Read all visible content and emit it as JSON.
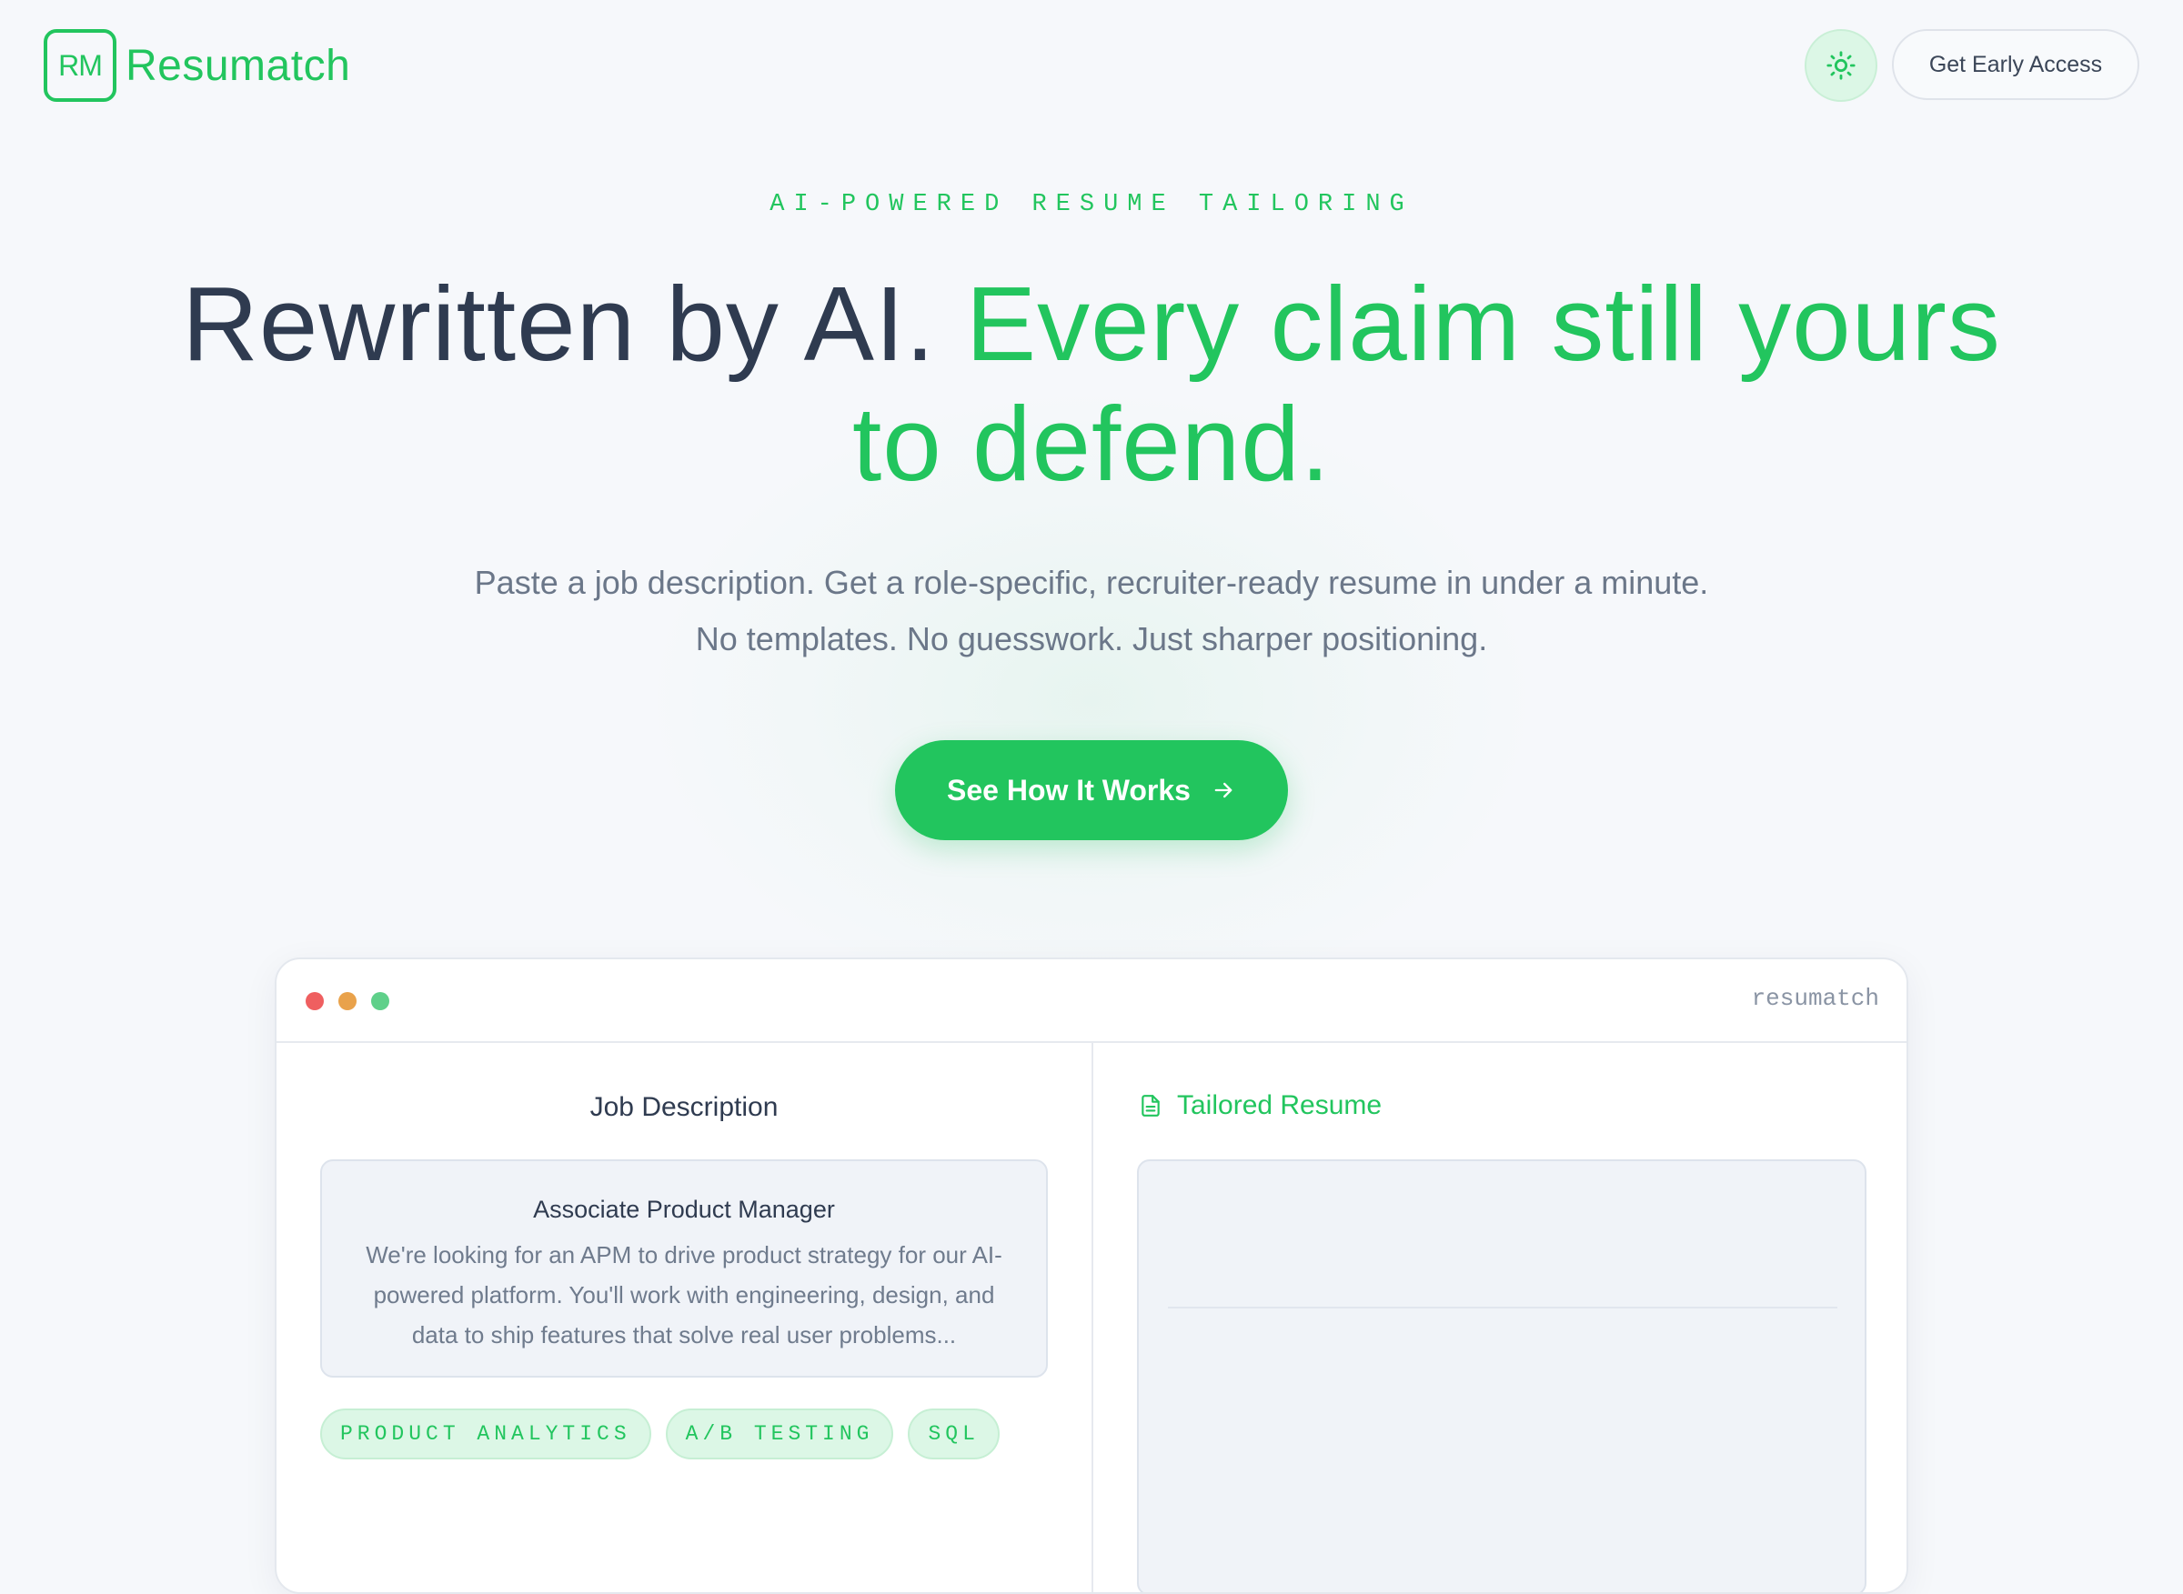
{
  "header": {
    "logo_mark": "RM",
    "logo_text": "Resumatch",
    "theme_icon": "sun-icon",
    "cta_label": "Get Early Access"
  },
  "hero": {
    "eyebrow": "AI-POWERED RESUME TAILORING",
    "headline_dark": "Rewritten by AI.",
    "headline_green": "Every claim still yours to defend.",
    "subhead": "Paste a job description. Get a role-specific, recruiter-ready resume in under a minute. No templates. No guesswork. Just sharper positioning.",
    "button_label": "See How It Works",
    "button_icon": "arrow-right-icon"
  },
  "demo": {
    "window_label": "resumatch",
    "left_panel": {
      "title": "Job Description",
      "job_title": "Associate Product Manager",
      "job_body": "We're looking for an APM to drive product strategy for our AI-powered platform. You'll work with engineering, design, and data to ship features that solve real user problems...",
      "tags": [
        "PRODUCT ANALYTICS",
        "A/B TESTING",
        "SQL"
      ]
    },
    "right_panel": {
      "title": "Tailored Resume",
      "title_icon": "document-icon"
    }
  },
  "colors": {
    "accent": "#22c55e",
    "text_dark": "#2f3b50",
    "text_muted": "#6b7789",
    "background": "#f6f8fb"
  }
}
